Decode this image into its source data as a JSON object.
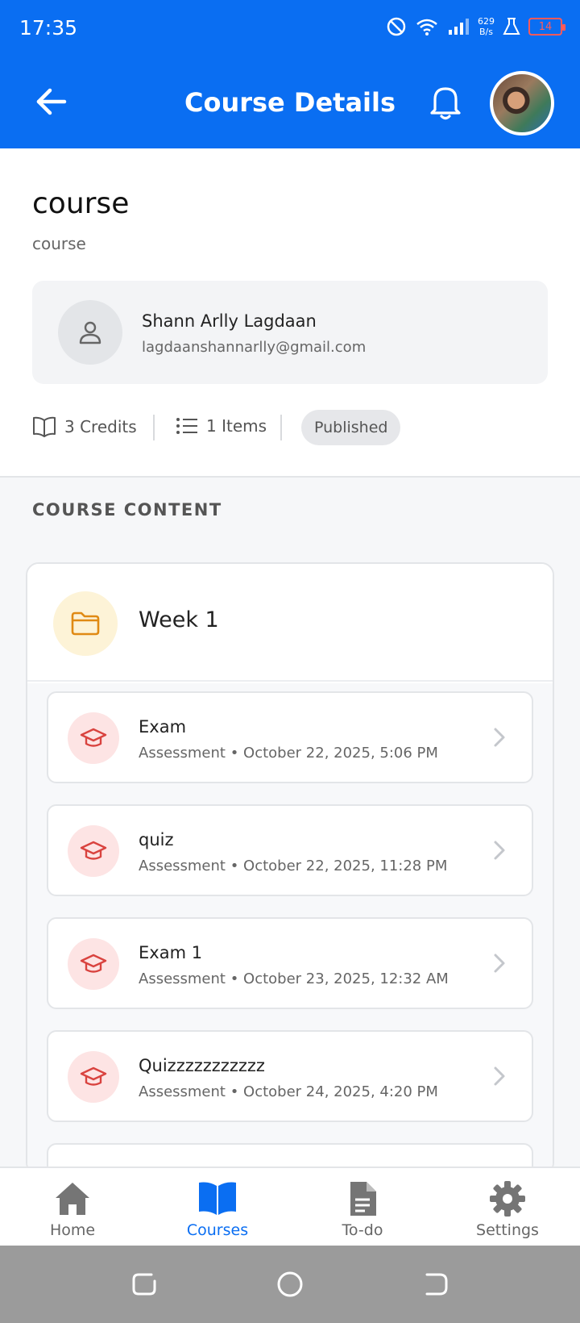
{
  "status_bar": {
    "time": "17:35",
    "net_speed_value": "629",
    "net_speed_unit": "B/s",
    "battery": "14"
  },
  "app_bar": {
    "title": "Course Details"
  },
  "course": {
    "title": "course",
    "subtitle": "course",
    "instructor": {
      "name": "Shann Arlly Lagdaan",
      "email": "lagdaanshannarlly@gmail.com"
    },
    "credits": "3 Credits",
    "items_count": "1 Items",
    "status": "Published"
  },
  "content": {
    "section_label": "COURSE CONTENT",
    "module": {
      "title": "Week 1",
      "items": [
        {
          "title": "Exam",
          "meta": "Assessment • October 22, 2025, 5:06 PM"
        },
        {
          "title": "quiz",
          "meta": "Assessment • October 22, 2025, 11:28 PM"
        },
        {
          "title": "Exam 1",
          "meta": "Assessment • October 23, 2025, 12:32 AM"
        },
        {
          "title": "Quizzzzzzzzzzz",
          "meta": "Assessment • October 24, 2025, 4:20 PM"
        }
      ]
    }
  },
  "bottom_nav": {
    "items": [
      {
        "label": "Home",
        "icon": "home-icon"
      },
      {
        "label": "Courses",
        "icon": "book-icon",
        "active": true
      },
      {
        "label": "To-do",
        "icon": "document-icon"
      },
      {
        "label": "Settings",
        "icon": "gear-icon"
      }
    ]
  },
  "colors": {
    "primary": "#0a6ef2",
    "folder_bg": "#fdf3d7",
    "assessment_bg": "#fde4e4",
    "assessment_icon": "#d9433f"
  }
}
